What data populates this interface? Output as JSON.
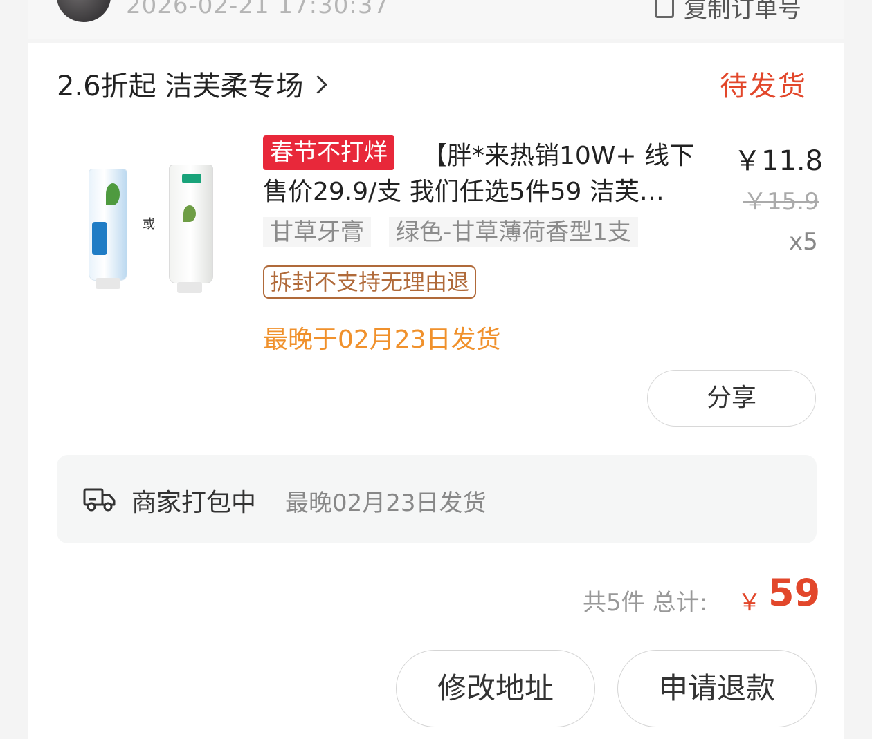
{
  "header": {
    "datetime": "2026-02-21 17:30:37",
    "copy_order_label": "复制订单号"
  },
  "store": {
    "title": "2.6折起 洁芙柔专场",
    "status": "待发货"
  },
  "product": {
    "image_or_text": "或",
    "promo_tag": "春节不打烊",
    "title": "【胖*来热销10W+ 线下售价29.9/支 我们任选5件59 洁芙…",
    "price": "￥11.8",
    "original_price": "￥15.9",
    "quantity": "x5",
    "sku_options": [
      "甘草牙膏",
      "绿色-甘草薄荷香型1支"
    ],
    "return_policy_tag": "拆封不支持无理由退",
    "ship_deadline": "最晚于02月23日发货",
    "share_label": "分享"
  },
  "logistics": {
    "status": "商家打包中",
    "detail": "最晚02月23日发货"
  },
  "summary": {
    "total_label": "共5件 总计:",
    "currency": "￥",
    "amount": "59"
  },
  "actions": {
    "modify_address": "修改地址",
    "request_refund": "申请退款"
  },
  "colors": {
    "accent": "#e2472b",
    "warning": "#f0912c",
    "promo": "#e8283a"
  }
}
